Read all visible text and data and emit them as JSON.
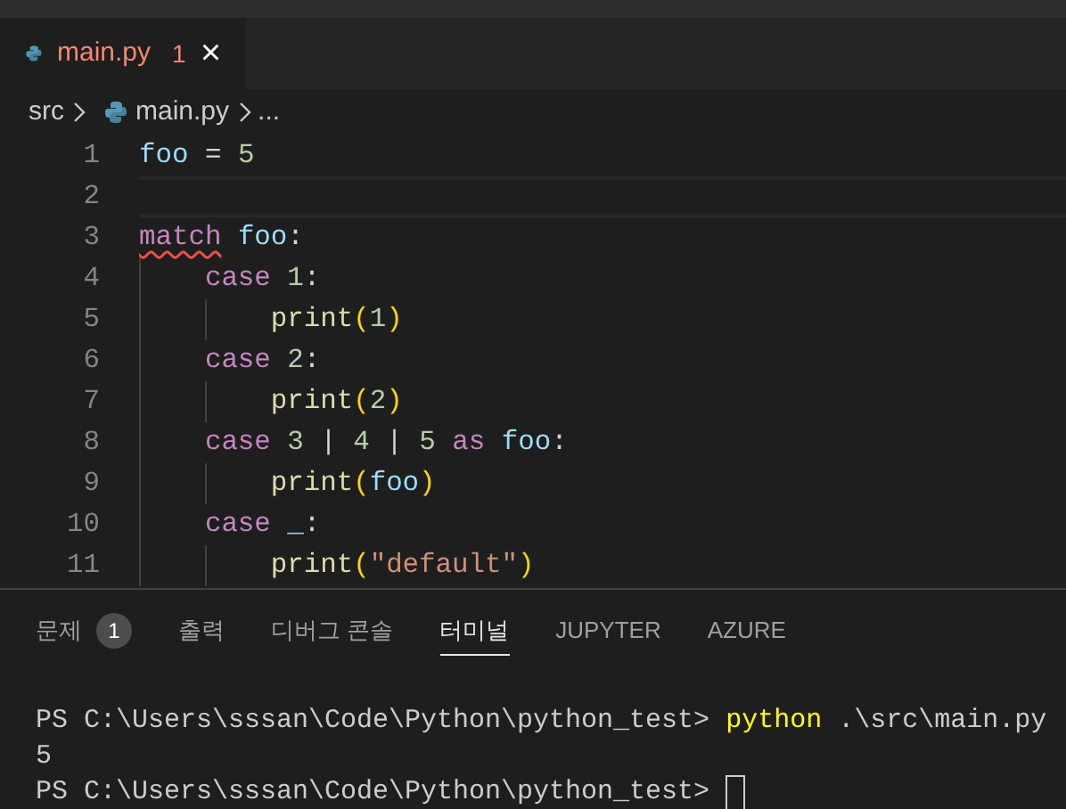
{
  "tab": {
    "label": "main.py",
    "problems": "1",
    "close": "×",
    "selected": true
  },
  "breadcrumb": {
    "folder": "src",
    "file": "main.py",
    "more": "..."
  },
  "editor": {
    "lines": [
      {
        "number": "1",
        "current": false,
        "tokens": [
          {
            "text": "foo",
            "kind": "variable"
          },
          {
            "text": " = ",
            "kind": "operator"
          },
          {
            "text": "5",
            "kind": "number"
          }
        ]
      },
      {
        "number": "2",
        "current": true
      },
      {
        "number": "3",
        "current": false,
        "tokens": [
          {
            "text": "match",
            "kind": "keyword_error"
          },
          {
            "text": " foo",
            "kind": "variable"
          },
          {
            "text": ":",
            "kind": "operator"
          }
        ]
      },
      {
        "number": "4",
        "current": false,
        "tokens": [
          {
            "text": "    case",
            "kind": "keyword"
          },
          {
            "text": " 1",
            "kind": "number"
          },
          {
            "text": ":",
            "kind": "operator"
          }
        ]
      },
      {
        "number": "5",
        "current": false,
        "tokens": [
          {
            "text": "        print",
            "kind": "function"
          },
          {
            "text": "(",
            "kind": "bracket"
          },
          {
            "text": "1",
            "kind": "number"
          },
          {
            "text": ")",
            "kind": "bracket"
          }
        ]
      },
      {
        "number": "6",
        "current": false,
        "tokens": [
          {
            "text": "    case",
            "kind": "keyword"
          },
          {
            "text": " 2",
            "kind": "number"
          },
          {
            "text": ":",
            "kind": "operator"
          }
        ]
      },
      {
        "number": "7",
        "current": false,
        "tokens": [
          {
            "text": "        print",
            "kind": "function"
          },
          {
            "text": "(",
            "kind": "bracket"
          },
          {
            "text": "2",
            "kind": "number"
          },
          {
            "text": ")",
            "kind": "bracket"
          }
        ]
      },
      {
        "number": "8",
        "current": false,
        "tokens": [
          {
            "text": "    case",
            "kind": "keyword"
          },
          {
            "text": " 3",
            "kind": "number"
          },
          {
            "text": " | ",
            "kind": "operator"
          },
          {
            "text": "4",
            "kind": "number"
          },
          {
            "text": " | ",
            "kind": "operator"
          },
          {
            "text": "5",
            "kind": "number"
          },
          {
            "text": " as",
            "kind": "keyword"
          },
          {
            "text": " foo",
            "kind": "variable"
          },
          {
            "text": ":",
            "kind": "operator"
          }
        ]
      },
      {
        "number": "9",
        "current": false,
        "tokens": [
          {
            "text": "        print",
            "kind": "function"
          },
          {
            "text": "(",
            "kind": "bracket"
          },
          {
            "text": "foo",
            "kind": "variable"
          },
          {
            "text": ")",
            "kind": "bracket"
          }
        ]
      },
      {
        "number": "10",
        "current": false,
        "tokens": [
          {
            "text": "    case",
            "kind": "keyword"
          },
          {
            "text": " _",
            "kind": "variable"
          },
          {
            "text": ":",
            "kind": "operator"
          }
        ]
      },
      {
        "number": "11",
        "current": false,
        "tokens": [
          {
            "text": "        print",
            "kind": "function"
          },
          {
            "text": "(",
            "kind": "bracket"
          },
          {
            "text": "\"default\"",
            "kind": "string"
          },
          {
            "text": ")",
            "kind": "bracket"
          }
        ]
      }
    ]
  },
  "panel": {
    "tabs": [
      {
        "label": "문제",
        "badge": "1",
        "selected": false
      },
      {
        "label": "출력",
        "selected": false
      },
      {
        "label": "디버그 콘솔",
        "selected": false
      },
      {
        "label": "터미널",
        "selected": true
      },
      {
        "label": "JUPYTER",
        "selected": false
      },
      {
        "label": "AZURE",
        "selected": false
      }
    ],
    "terminal": [
      {
        "segments": [
          {
            "text": "PS C:\\Users\\sssan\\Code\\Python\\python_test> ",
            "kind": "prompt"
          },
          {
            "text": "python",
            "kind": "command"
          },
          {
            "text": " .\\src\\main.py",
            "kind": "argument"
          }
        ],
        "cursor": false
      },
      {
        "segments": [
          {
            "text": "5",
            "kind": "output"
          }
        ],
        "cursor": false
      },
      {
        "segments": [
          {
            "text": "PS C:\\Users\\sssan\\Code\\Python\\python_test> ",
            "kind": "prompt"
          }
        ],
        "cursor": true
      }
    ]
  }
}
